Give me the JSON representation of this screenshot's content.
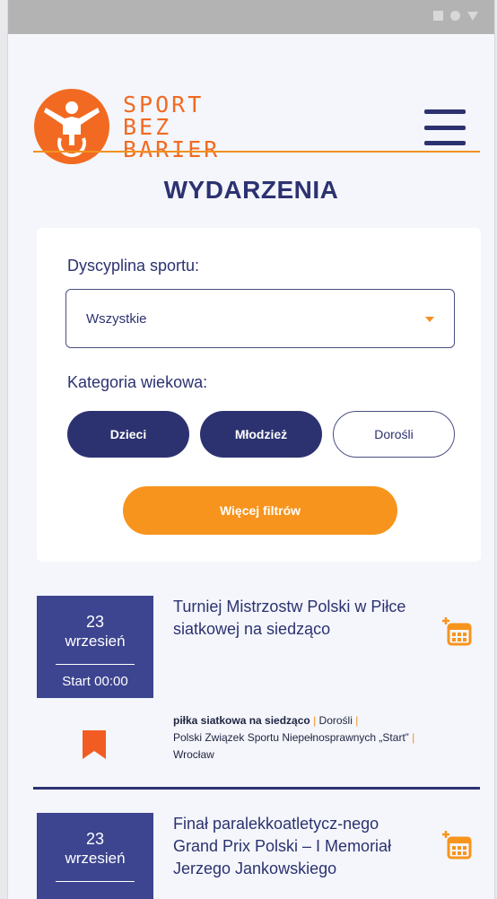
{
  "brand": {
    "line1": "SPORT",
    "line2": "BEZ",
    "line3": "BARIER"
  },
  "page_title": "WYDARZENIA",
  "filters": {
    "sport_label": "Dyscyplina sportu:",
    "sport_value": "Wszystkie",
    "age_label": "Kategoria wiekowa:",
    "age_options": [
      {
        "label": "Dzieci",
        "selected": true
      },
      {
        "label": "Młodzież",
        "selected": true
      },
      {
        "label": "Dorośli",
        "selected": false
      }
    ],
    "more_button": "Więcej filtrów"
  },
  "events": [
    {
      "day": "23",
      "month": "wrzesień",
      "start": "Start 00:00",
      "title": "Turniej Mistrzostw Polski w Piłce siatkowej na siedząco",
      "discipline": "piłka siatkowa na siedząco",
      "age": "Dorośli",
      "organizer": "Polski Związek Sportu Niepełnosprawnych „Start”",
      "city": "Wrocław"
    },
    {
      "day": "23",
      "month": "wrzesień",
      "title": "Finał paralekkoatletycz-nego Grand Prix Polski – I Memoriał Jerzego Jankowskiego"
    }
  ],
  "icons": {
    "logo": "wheelchair-athlete-logo",
    "menu": "hamburger-menu-icon",
    "calendar": "add-to-calendar-icon",
    "bookmark": "bookmark-icon"
  },
  "colors": {
    "navy": "#2c3270",
    "orange": "#f7941d",
    "date_bg": "#3d4590",
    "bookmark": "#f25c22"
  }
}
